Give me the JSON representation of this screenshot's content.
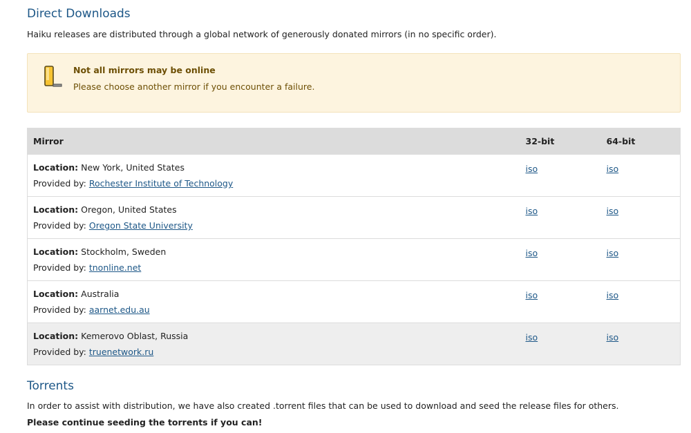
{
  "direct": {
    "title": "Direct Downloads",
    "intro": "Haiku releases are distributed through a global network of generously donated mirrors (in no specific order)."
  },
  "notice": {
    "icon": "warning-bookmark-icon",
    "title": "Not all mirrors may be online",
    "text": "Please choose another mirror if you encounter a failure."
  },
  "table": {
    "headers": {
      "mirror": "Mirror",
      "bit32": "32-bit",
      "bit64": "64-bit"
    },
    "location_label": "Location:",
    "provided_label": "Provided by:",
    "rows": [
      {
        "location": "New York, United States",
        "provider": "Rochester Institute of Technology",
        "iso32": "iso",
        "iso64": "iso"
      },
      {
        "location": "Oregon, United States",
        "provider": "Oregon State University",
        "iso32": "iso",
        "iso64": "iso"
      },
      {
        "location": "Stockholm, Sweden",
        "provider": "tnonline.net",
        "iso32": "iso",
        "iso64": "iso"
      },
      {
        "location": "Australia",
        "provider": "aarnet.edu.au",
        "iso32": "iso",
        "iso64": "iso"
      },
      {
        "location": "Kemerovo Oblast, Russia",
        "provider": "truenetwork.ru",
        "iso32": "iso",
        "iso64": "iso"
      }
    ]
  },
  "torrents": {
    "title": "Torrents",
    "intro": "In order to assist with distribution, we have also created .torrent files that can be used to download and seed the release files for others.",
    "bold": "Please continue seeding the torrents if you can!"
  },
  "colors": {
    "heading": "#1d5787",
    "link": "#1d5787",
    "notice_bg": "#fdf4df",
    "notice_text": "#6d4f05",
    "table_header_bg": "#dcdcdc",
    "row_highlight_bg": "#eeeeee"
  }
}
